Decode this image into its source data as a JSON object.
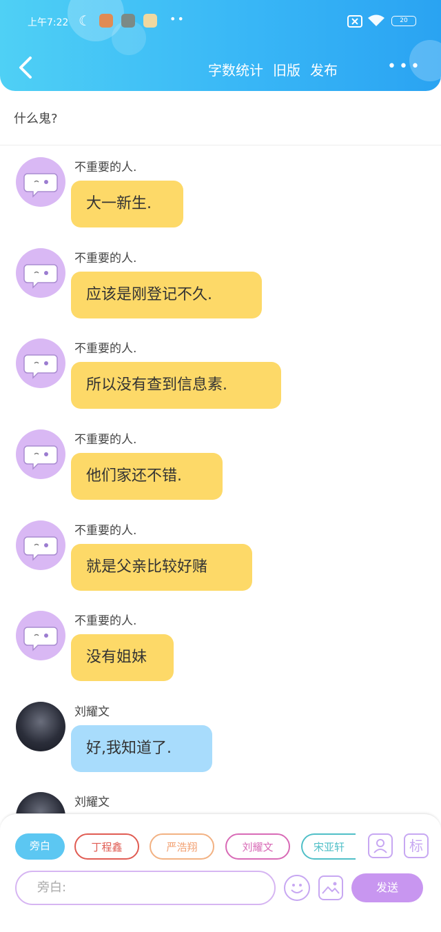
{
  "status_bar": {
    "time": "上午7:22",
    "battery": "20",
    "icons": [
      "moon-icon",
      "shield-app-icon",
      "camera-app-icon",
      "wechat-app-icon",
      "more-dots-icon",
      "sim-off-icon",
      "wifi-icon",
      "battery-icon"
    ]
  },
  "header": {
    "back_icon": "chevron-left-icon",
    "word_count": "字数统计",
    "old_version": "旧版",
    "publish": "发布",
    "more_icon": "more-horizontal-icon",
    "colors": {
      "gradient_start": "#4fd0f5",
      "gradient_end": "#2aa3f2"
    }
  },
  "subtitle": "什么鬼?",
  "messages": [
    {
      "sender": "不重要的人.",
      "text": "大一新生.",
      "avatar": "chat-bubble-face-icon",
      "style": "yellow"
    },
    {
      "sender": "不重要的人.",
      "text": "应该是刚登记不久.",
      "avatar": "chat-bubble-face-icon",
      "style": "yellow"
    },
    {
      "sender": "不重要的人.",
      "text": "所以没有查到信息素.",
      "avatar": "chat-bubble-face-icon",
      "style": "yellow"
    },
    {
      "sender": "不重要的人.",
      "text": "他们家还不错.",
      "avatar": "chat-bubble-face-icon",
      "style": "yellow"
    },
    {
      "sender": "不重要的人.",
      "text": "就是父亲比较好赌",
      "avatar": "chat-bubble-face-icon",
      "style": "yellow"
    },
    {
      "sender": "不重要的人.",
      "text": "没有姐妹",
      "avatar": "chat-bubble-face-icon",
      "style": "yellow"
    },
    {
      "sender": "刘耀文",
      "text": "好,我知道了.",
      "avatar": "photo-avatar",
      "style": "blue"
    },
    {
      "sender": "刘耀文",
      "text": "",
      "avatar": "photo-avatar",
      "style": "blue"
    }
  ],
  "bottom": {
    "chips": [
      "旁白",
      "丁程鑫",
      "严浩翔",
      "刘耀文",
      "宋亚轩"
    ],
    "active_chip": "旁白",
    "icons": [
      "person-card-icon",
      "tag-mark-icon",
      "emoji-icon",
      "image-icon"
    ],
    "tag_label": "标",
    "input_placeholder": "旁白:",
    "send_label": "发送",
    "colors": {
      "accent": "#c896f0",
      "active_chip": "#5cc7f2"
    }
  }
}
